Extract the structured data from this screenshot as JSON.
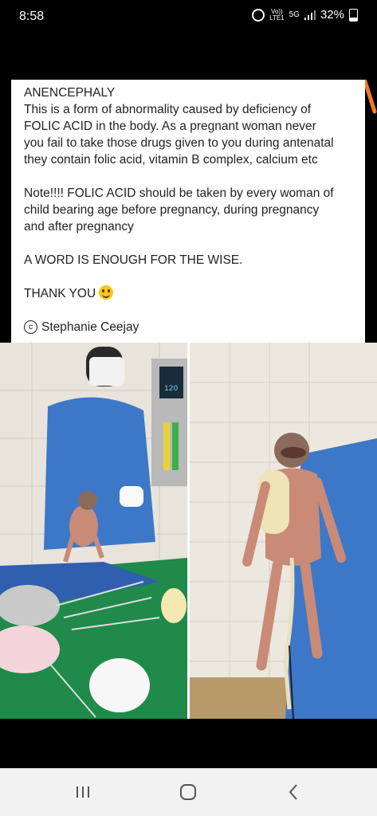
{
  "status_bar": {
    "time": "8:58",
    "volte_top": "Vo))",
    "volte_bottom": "LTE1",
    "network": "5G",
    "battery": "32%"
  },
  "post": {
    "lines": [
      "ANENCEPHALY",
      "This is a form of abnormality caused by deficiency of",
      "FOLIC ACID in the body.  As a pregnant woman never",
      "you fail to take those drugs given to you during antenatal",
      "they contain folic acid, vitamin B complex, calcium etc"
    ],
    "note_lines": [
      "Note!!!! FOLIC ACID should be taken by every woman of",
      "child bearing age before pregnancy, during pregnancy",
      "and after pregnancy"
    ],
    "wise": "A WORD IS ENOUGH FOR THE WISE.",
    "thanks": "THANK YOU",
    "author": "Stephanie Ceejay"
  },
  "photos": {
    "monitor_readout": "120"
  },
  "colors": {
    "gown": "#3d78c8",
    "drape_green": "#1f8a4a",
    "tile": "#e9e6de",
    "skin": "#c98a78"
  },
  "icons": [
    "alarm-icon",
    "signal-icon",
    "battery-icon",
    "smiley-icon",
    "copyright-icon",
    "recents-icon",
    "home-icon",
    "back-icon"
  ]
}
